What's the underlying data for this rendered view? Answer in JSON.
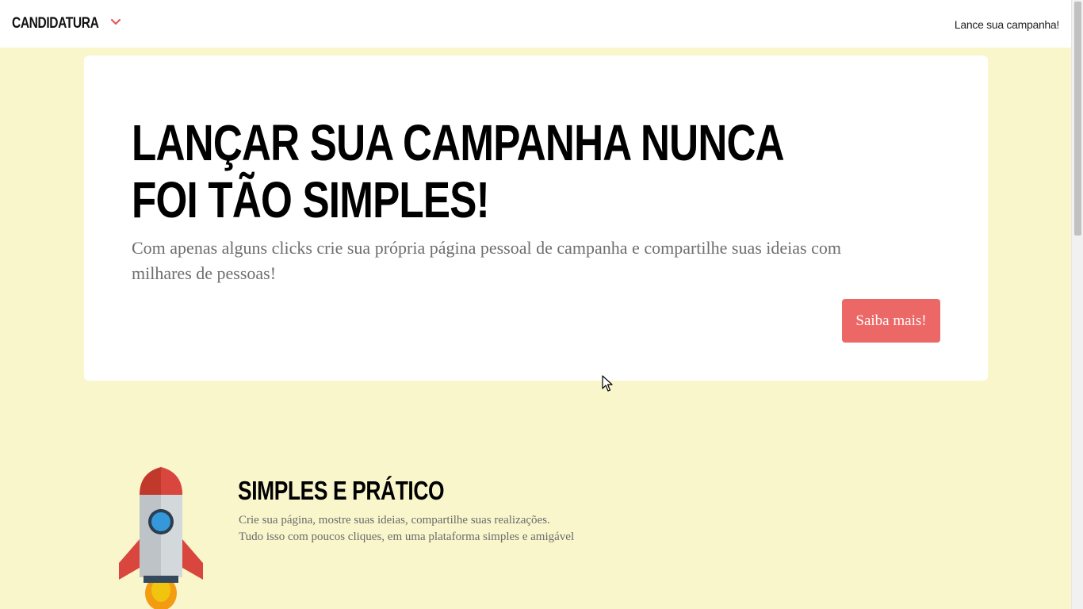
{
  "navbar": {
    "brand": "CANDIDATURA",
    "brand_caret_icon": "chevron-down-icon",
    "link": "Lance sua campanha!"
  },
  "hero": {
    "title_line1": "LANÇAR SUA CAMPANHA NUNCA",
    "title_line2": "FOI TÃO SIMPLES!",
    "subtitle": "Com apenas alguns clicks crie sua própria página pessoal de campanha e compartilhe suas ideias com milhares de pessoas!",
    "button_label": "Saiba mais!"
  },
  "feature": {
    "icon": "rocket-icon",
    "title": "SIMPLES E PRÁTICO",
    "text_line1": "Crie sua página, mostre suas ideias, compartilhe suas realizações.",
    "text_line2": "Tudo isso com poucos cliques, em uma plataforma simples e amigável"
  },
  "colors": {
    "page_background": "#f9f6cc",
    "accent": "#ec6866",
    "card_background": "#ffffff"
  }
}
